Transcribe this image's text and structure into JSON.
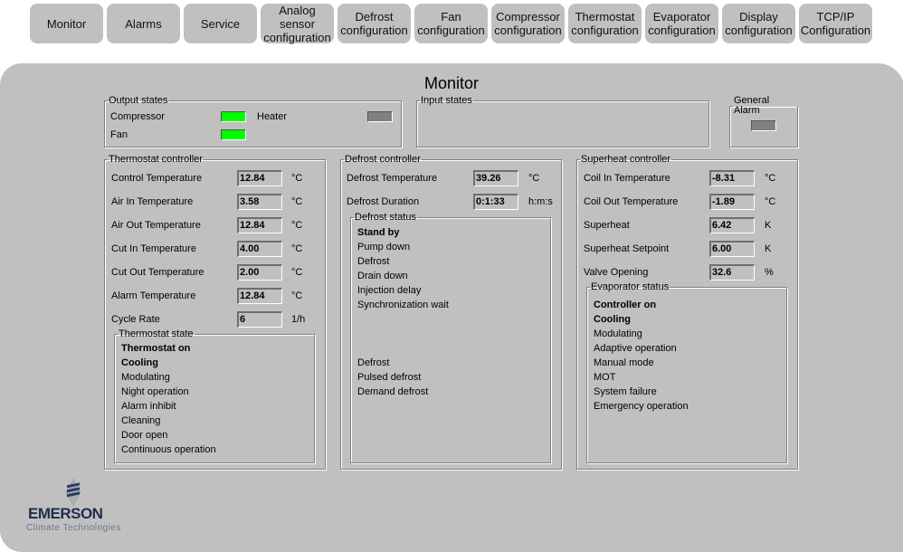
{
  "tabs": [
    {
      "label": "Monitor"
    },
    {
      "label": "Alarms"
    },
    {
      "label": "Service"
    },
    {
      "label": "Analog\nsensor\nconfiguration"
    },
    {
      "label": "Defrost\nconfiguration"
    },
    {
      "label": "Fan\nconfiguration"
    },
    {
      "label": "Compressor\nconfiguration"
    },
    {
      "label": "Thermostat\nconfiguration"
    },
    {
      "label": "Evaporator\nconfiguration"
    },
    {
      "label": "Display\nconfiguration"
    },
    {
      "label": "TCP/IP\nConfiguration"
    }
  ],
  "page_title": "Monitor",
  "output_states": {
    "title": "Output states",
    "compressor": {
      "label": "Compressor",
      "state": "on",
      "color": "#00ff00"
    },
    "heater": {
      "label": "Heater",
      "state": "off",
      "color": "#808080"
    },
    "fan": {
      "label": "Fan",
      "state": "on",
      "color": "#00ff00"
    }
  },
  "input_states": {
    "title": "Input states"
  },
  "general_alarm": {
    "title": "General Alarm",
    "state": "off",
    "color": "#808080"
  },
  "thermostat": {
    "title": "Thermostat controller",
    "rows": [
      {
        "label": "Control Temperature",
        "value": "12.84",
        "unit": "°C"
      },
      {
        "label": "Air In Temperature",
        "value": "3.58",
        "unit": "°C"
      },
      {
        "label": "Air Out Temperature",
        "value": "12.84",
        "unit": "°C"
      },
      {
        "label": "Cut In Temperature",
        "value": "4.00",
        "unit": "°C"
      },
      {
        "label": "Cut Out Temperature",
        "value": "2.00",
        "unit": "°C"
      },
      {
        "label": "Alarm Temperature",
        "value": "12.84",
        "unit": "°C"
      },
      {
        "label": "Cycle Rate",
        "value": "6",
        "unit": "1/h"
      }
    ],
    "state_title": "Thermostat state",
    "states": [
      {
        "label": "Thermostat on",
        "active": true
      },
      {
        "label": "Cooling",
        "active": true
      },
      {
        "label": "Modulating",
        "active": false
      },
      {
        "label": "Night operation",
        "active": false
      },
      {
        "label": "Alarm inhibit",
        "active": false
      },
      {
        "label": "Cleaning",
        "active": false
      },
      {
        "label": "Door open",
        "active": false
      },
      {
        "label": "Continuous operation",
        "active": false
      }
    ]
  },
  "defrost": {
    "title": "Defrost controller",
    "rows": [
      {
        "label": "Defrost Temperature",
        "value": "39.26",
        "unit": "°C"
      },
      {
        "label": "Defrost Duration",
        "value": "0:1:33",
        "unit": "h:m:s"
      }
    ],
    "status_title": "Defrost status",
    "states": [
      {
        "label": "Stand by",
        "active": true
      },
      {
        "label": "Pump down",
        "active": false
      },
      {
        "label": "Defrost",
        "active": false
      },
      {
        "label": "Drain down",
        "active": false
      },
      {
        "label": "Injection delay",
        "active": false
      },
      {
        "label": "Synchronization wait",
        "active": false
      }
    ],
    "types": [
      {
        "label": "Defrost",
        "active": false
      },
      {
        "label": "Pulsed defrost",
        "active": false
      },
      {
        "label": "Demand defrost",
        "active": false
      }
    ]
  },
  "superheat": {
    "title": "Superheat controller",
    "rows": [
      {
        "label": "Coil In Temperature",
        "value": "-8.31",
        "unit": "°C"
      },
      {
        "label": "Coil Out Temperature",
        "value": "-1.89",
        "unit": "°C"
      },
      {
        "label": "Superheat",
        "value": "6.42",
        "unit": "K"
      },
      {
        "label": "Superheat Setpoint",
        "value": "6.00",
        "unit": "K"
      },
      {
        "label": "Valve Opening",
        "value": "32.6",
        "unit": "%"
      }
    ],
    "status_title": "Evaporator status",
    "states": [
      {
        "label": "Controller on",
        "active": true
      },
      {
        "label": "Cooling",
        "active": true
      },
      {
        "label": "Modulating",
        "active": false
      },
      {
        "label": "Adaptive operation",
        "active": false
      },
      {
        "label": "Manual mode",
        "active": false
      },
      {
        "label": "MOT",
        "active": false
      },
      {
        "label": "System failure",
        "active": false
      },
      {
        "label": "Emergency operation",
        "active": false
      }
    ]
  },
  "logo": {
    "brand": "EMERSON",
    "subtitle": "Climate Technologies",
    "brand_color": "#1f2d4d",
    "subtitle_color": "#6a7a8a"
  }
}
